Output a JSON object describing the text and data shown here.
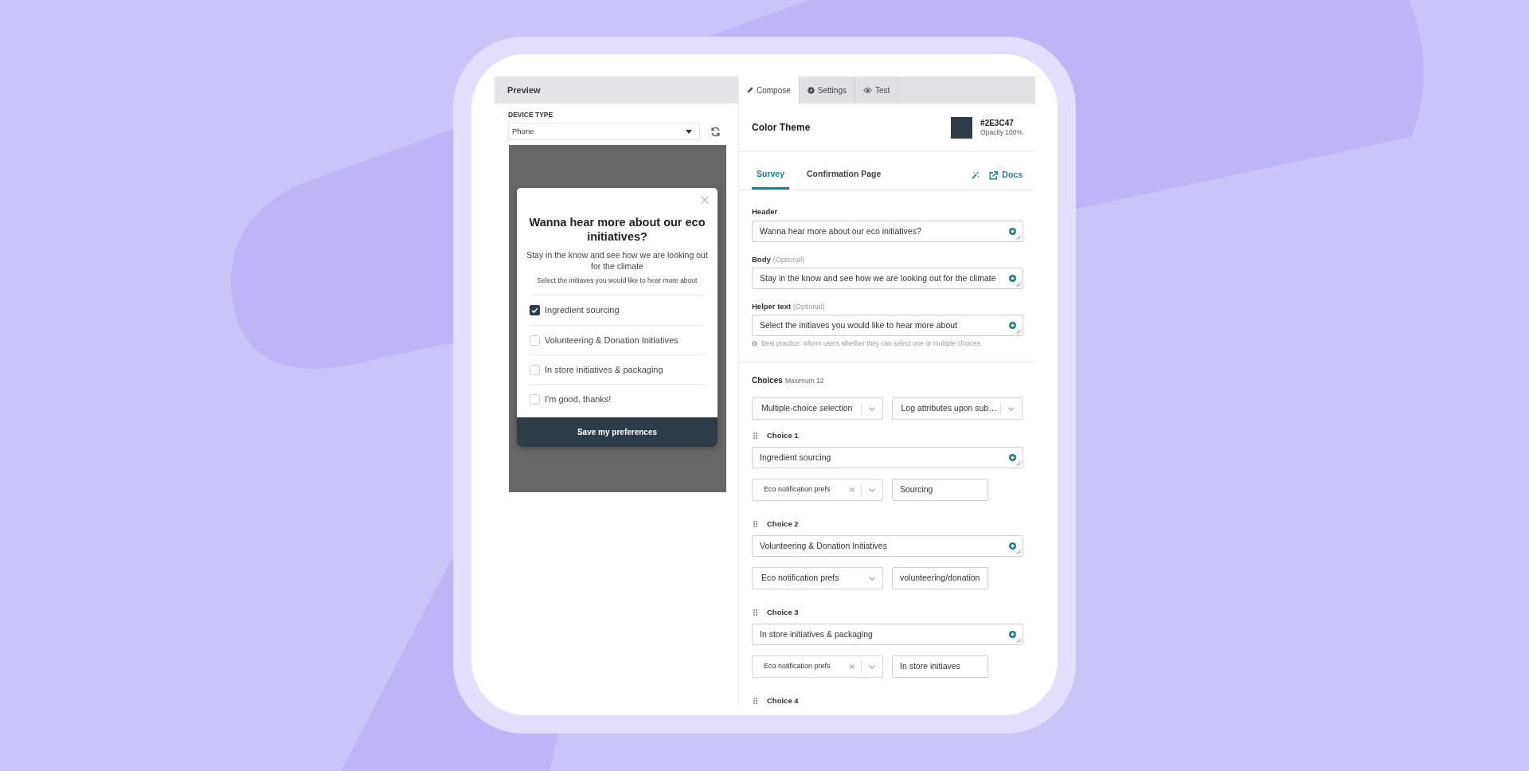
{
  "preview": {
    "title": "Preview",
    "device_type": {
      "label": "DEVICE TYPE",
      "value": "Phone"
    },
    "popup": {
      "title": "Wanna hear more about our eco initiatives?",
      "body": "Stay in the know and see how we are looking out for the climate",
      "helper": "Select the initiaves you would like to hear more about",
      "options": [
        {
          "label": "Ingredient sourcing",
          "checked": true
        },
        {
          "label": "Volunteering & Donation Initiatives",
          "checked": false
        },
        {
          "label": "In store initiatives & packaging",
          "checked": false
        },
        {
          "label": "I'm good, thanks!",
          "checked": false
        }
      ],
      "button": "Save my preferences"
    }
  },
  "editor": {
    "tabs": [
      {
        "label": "Compose",
        "selected": true
      },
      {
        "label": "Settings",
        "selected": false
      },
      {
        "label": "Test",
        "selected": false
      }
    ],
    "color_theme": {
      "label": "Color Theme",
      "color": "#2e3c47",
      "hex": "#2E3C47",
      "opacity": "Opacity 100%"
    },
    "subtabs": [
      {
        "label": "Survey",
        "selected": true
      },
      {
        "label": "Confirmation Page",
        "selected": false
      }
    ],
    "docs_link": "Docs",
    "fields": [
      {
        "label": "Header",
        "value": "Wanna hear more about our eco initiatives?"
      },
      {
        "label": "Body",
        "note": "(Optional)",
        "value": "Stay in the know and see how we are looking out for the climate"
      },
      {
        "label": "Helper text",
        "note": "(Optional)",
        "value": "Select the initiaves you would like to hear more about"
      }
    ],
    "hint": "Best practice: inform users whether they can select one or multiple choices.",
    "choices": {
      "label": "Choices",
      "note": "Maximum 12",
      "selection_type": "Multiple-choice selection",
      "log_option": "Log attributes upon sub…",
      "items": [
        {
          "label": "Choice 1",
          "value": "Ingredient sourcing",
          "attribute": "Eco notification prefs",
          "clearable": true,
          "attribute_value": "Sourcing"
        },
        {
          "label": "Choice 2",
          "value": "Volunteering & Donation Initiatives",
          "attribute": "Eco notification prefs",
          "clearable": false,
          "attribute_value": "volunteering/donation"
        },
        {
          "label": "Choice 3",
          "value": "In store initiatives & packaging",
          "attribute": "Eco notification prefs",
          "clearable": true,
          "attribute_value": "In store initiaves"
        },
        {
          "label": "Choice 4"
        }
      ]
    }
  }
}
